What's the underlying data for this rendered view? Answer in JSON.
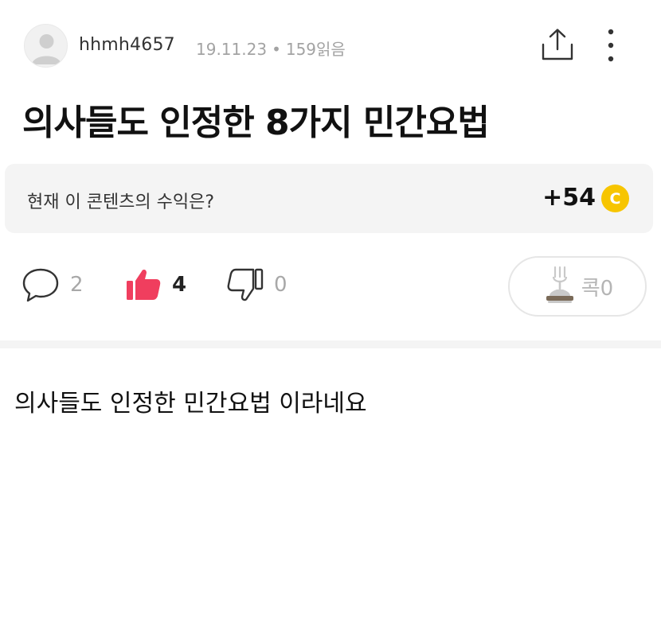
{
  "header": {
    "username": "hhmh4657",
    "date": "19.11.23",
    "separator": "•",
    "views": "159읽음"
  },
  "post": {
    "title": "의사들도 인정한 8가지 민간요법",
    "body": "의사들도 인정한 민간요법 이라네요"
  },
  "revenue": {
    "label": "현재 이 콘텐츠의 수익은?",
    "value": "+54",
    "coin_symbol": "C",
    "coin_color": "#f7c500"
  },
  "actions": {
    "comments": "2",
    "likes": "4",
    "dislikes": "0",
    "kok_label": "콕0",
    "like_color": "#f03e5e"
  },
  "icons": {
    "share": "share-icon",
    "more": "more-vertical-icon",
    "comment": "comment-bubble-icon",
    "like": "thumbs-up-icon",
    "dislike": "thumbs-down-icon",
    "kok": "fork-icon"
  }
}
